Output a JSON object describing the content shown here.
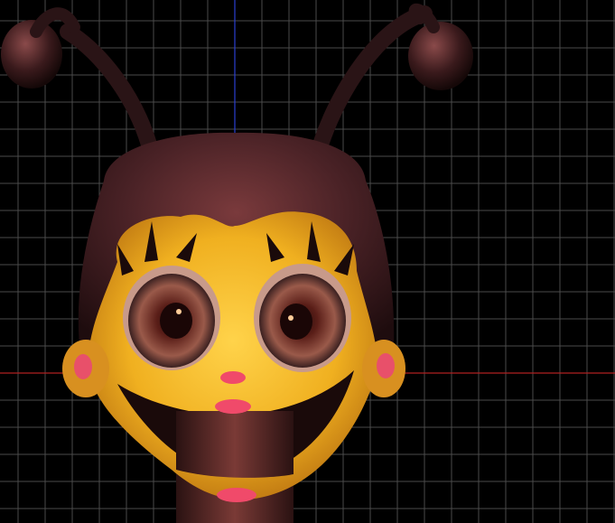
{
  "viewport": {
    "background_color": "#000000",
    "grid_color": "#4a4a4a",
    "x_axis_color": "#b02020",
    "y_axis_color": "#2a3fd0"
  },
  "character": {
    "head_color": "#3a1c1e",
    "face_color": "#f0b020",
    "eye_color": "#6a2a24",
    "cheek_color": "#e8506a",
    "lip_color": "#f04a6a",
    "antenna_color": "#2a1416",
    "neck_color": "#5a2a28"
  }
}
